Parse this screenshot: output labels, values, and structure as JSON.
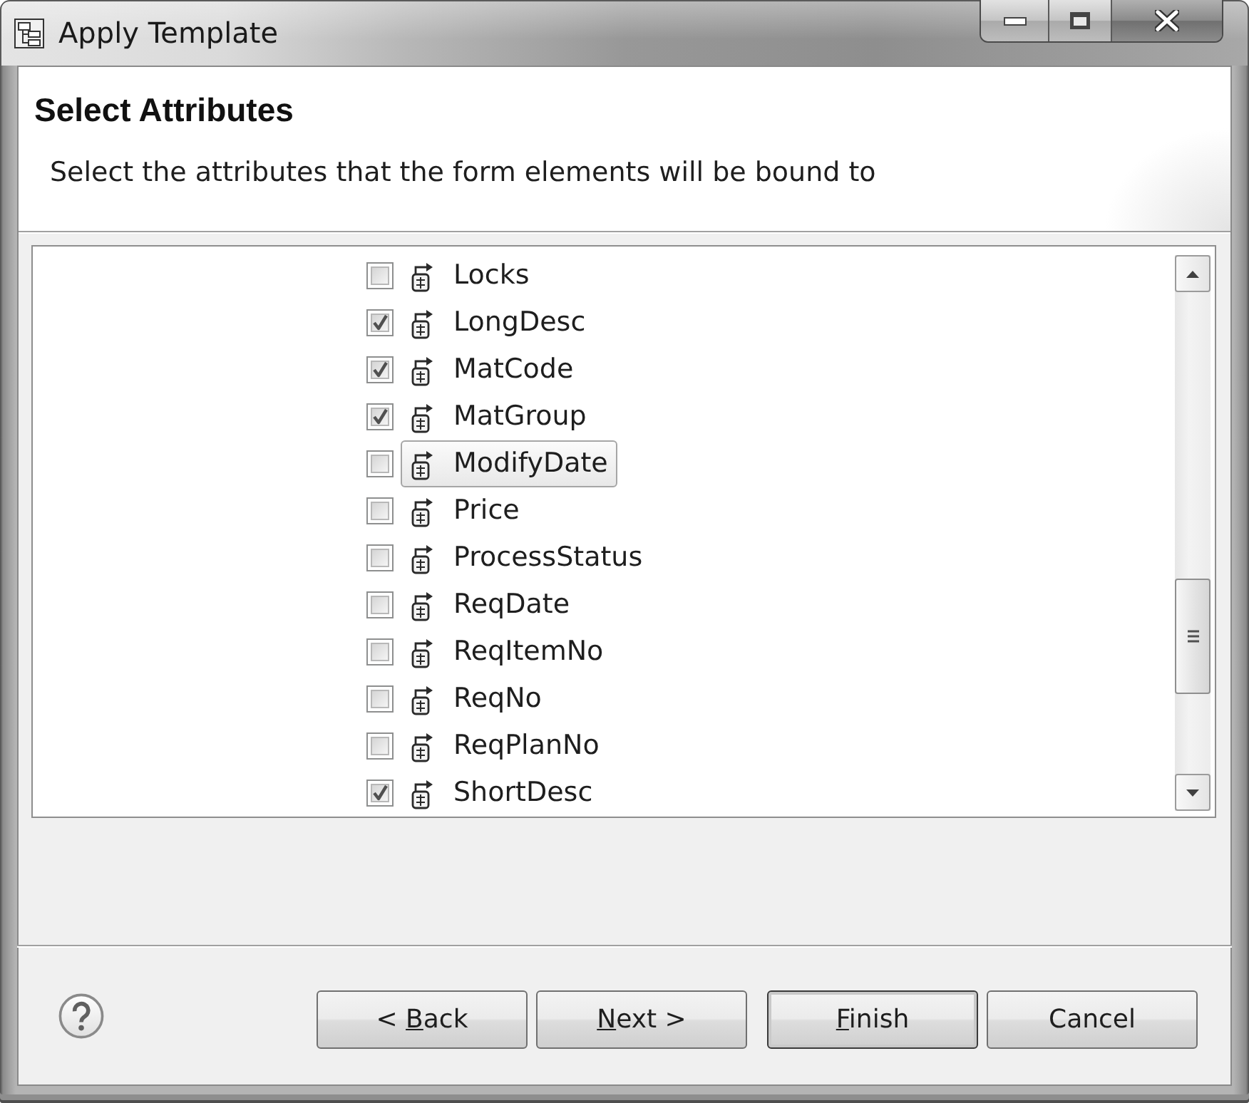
{
  "window": {
    "title": "Apply Template"
  },
  "header": {
    "title": "Select Attributes",
    "description": "Select the attributes that the form elements will be bound to"
  },
  "attributes": [
    {
      "name": "Locks",
      "checked": false,
      "selected": false
    },
    {
      "name": "LongDesc",
      "checked": true,
      "selected": false
    },
    {
      "name": "MatCode",
      "checked": true,
      "selected": false
    },
    {
      "name": "MatGroup",
      "checked": true,
      "selected": false
    },
    {
      "name": "ModifyDate",
      "checked": false,
      "selected": true
    },
    {
      "name": "Price",
      "checked": false,
      "selected": false
    },
    {
      "name": "ProcessStatus",
      "checked": false,
      "selected": false
    },
    {
      "name": "ReqDate",
      "checked": false,
      "selected": false
    },
    {
      "name": "ReqItemNo",
      "checked": false,
      "selected": false
    },
    {
      "name": "ReqNo",
      "checked": false,
      "selected": false
    },
    {
      "name": "ReqPlanNo",
      "checked": false,
      "selected": false
    },
    {
      "name": "ShortDesc",
      "checked": true,
      "selected": false
    }
  ],
  "navigation_buttons": [
    {
      "prefix": "< ",
      "access_key": "B",
      "suffix": "ack",
      "default": false
    },
    {
      "access_key": "N",
      "suffix": "ext >",
      "default": false
    }
  ],
  "buttons": [
    {
      "access_key": "F",
      "suffix": "inish",
      "default": true
    },
    {
      "prefix": "Cancel",
      "default": false
    }
  ]
}
